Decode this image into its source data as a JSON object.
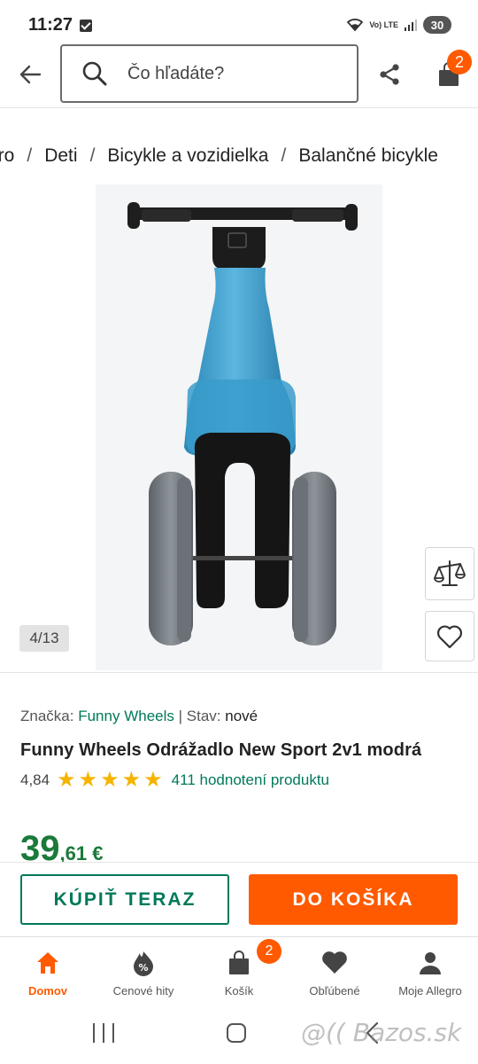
{
  "status_bar": {
    "time": "11:27",
    "network": "Vo) LTE",
    "battery": "30"
  },
  "header": {
    "search_placeholder": "Čo hľadáte?",
    "cart_count": "2"
  },
  "breadcrumb": [
    {
      "label": "gro"
    },
    {
      "label": "Deti"
    },
    {
      "label": "Bicykle a vozidielka"
    },
    {
      "label": "Balančné bicykle"
    }
  ],
  "breadcrumb_separator": "/",
  "gallery": {
    "counter": "4/13"
  },
  "product": {
    "brand_label": "Značka:",
    "brand": "Funny Wheels",
    "separator": "|",
    "state_label": "Stav:",
    "state": "nové",
    "title": "Funny Wheels Odrážadlo New Sport 2v1 modrá",
    "rating": "4,84",
    "stars": 5,
    "rating_count": "411 hodnotení produktu",
    "price_main": "39",
    "price_decimal": ",61 €"
  },
  "actions": {
    "buy_now": "KÚPIŤ TERAZ",
    "add_to_cart": "DO KOŠÍKA"
  },
  "bottom_nav": [
    {
      "label": "Domov",
      "icon": "home-icon",
      "active": true
    },
    {
      "label": "Cenové hity",
      "icon": "price-hits-icon",
      "active": false
    },
    {
      "label": "Košík",
      "icon": "cart-icon",
      "active": false
    },
    {
      "label": "Obľúbené",
      "icon": "heart-icon",
      "active": false
    },
    {
      "label": "Moje Allegro",
      "icon": "person-icon",
      "active": false
    }
  ],
  "bottom_nav_badge": "2",
  "watermark": "@(( Bazos.sk",
  "colors": {
    "accent": "#ff5a00",
    "link": "#00795a",
    "price": "#1a7a3a",
    "star": "#f5b400"
  }
}
